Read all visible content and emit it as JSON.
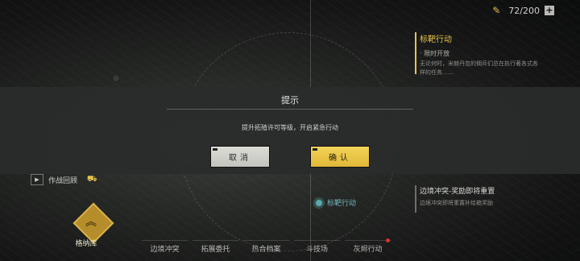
{
  "top_bar": {
    "resource_count": "72/200",
    "plus_label": "+"
  },
  "quest_panel": {
    "title": "标靶行动",
    "subtitle": "· 限时开放",
    "description": "无论何时，米赫丹忽的佣兵们总在执行著各式各样的任务……"
  },
  "mission_panel": {
    "title": "边境冲突-奖励即将重置",
    "description": "边境冲突即将重置补给箱奖励"
  },
  "playback": {
    "label": "作战回顾"
  },
  "map_target": {
    "label": "标靶行动"
  },
  "badge": {
    "label": "格纳库"
  },
  "nav": {
    "items": [
      {
        "label": "边境冲突"
      },
      {
        "label": "拓展委托"
      },
      {
        "label": "热合档案"
      },
      {
        "label": "斗技场"
      },
      {
        "label": "灰烬行动"
      }
    ]
  },
  "dialog": {
    "title": "提示",
    "message": "提升拓殖许可等级，开启紧急行动",
    "cancel_label": "取消",
    "confirm_label": "确认"
  },
  "colors": {
    "accent_gold": "#e6c34b",
    "notice_red": "#d8342a",
    "target_teal": "#5aa8aa"
  }
}
